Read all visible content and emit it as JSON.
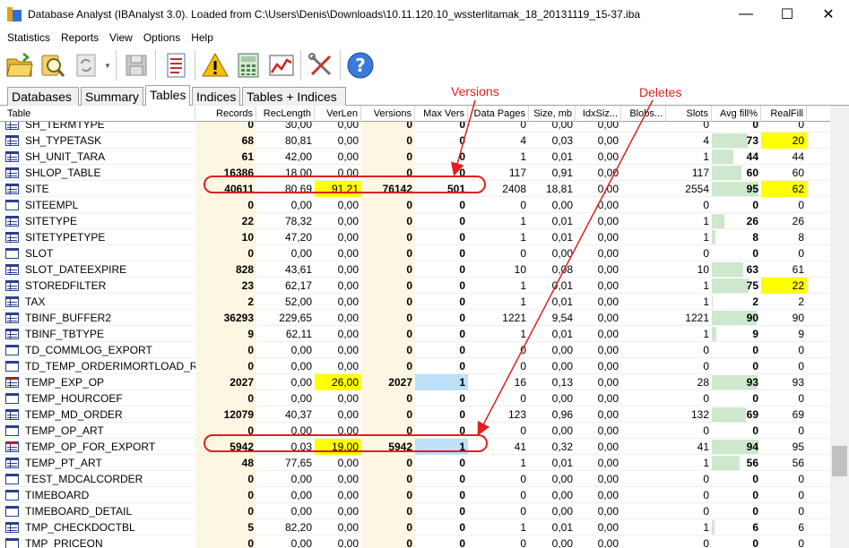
{
  "window": {
    "title": "Database Analyst (IBAnalyst 3.0). Loaded from C:\\Users\\Denis\\Downloads\\10.11.120.10_wssterlitamak_18_20131119_15-37.iba",
    "minimize": "—",
    "maximize": "☐",
    "close": "✕"
  },
  "menu": [
    "Statistics",
    "Reports",
    "View",
    "Options",
    "Help"
  ],
  "toolbar": [
    "open-folder-icon",
    "search-database-icon",
    "refresh-icon",
    "save-icon",
    "report-icon",
    "warning-icon",
    "calculator-icon",
    "chart-icon",
    "tools-icon",
    "help-icon"
  ],
  "tabs": [
    "Databases",
    "Summary",
    "Tables",
    "Indices",
    "Tables + Indices"
  ],
  "active_tab": "Tables",
  "columns": [
    "Table",
    "Records",
    "RecLength",
    "VerLen",
    "Versions",
    "Max Vers",
    "Data Pages",
    "Size, mb",
    "IdxSiz...",
    "Blobs...",
    "Slots",
    "Avg fill%",
    "RealFill"
  ],
  "rows": [
    {
      "name": "SH_TERMTYPE",
      "records": "0",
      "reclength": "30,00",
      "verlen": "0,00",
      "versions": "0",
      "maxvers": "0",
      "datapages": "0",
      "size": "0,00",
      "idxsize": "0,00",
      "blobs": "",
      "slots": "0",
      "avgfill": "0",
      "realfill": "0"
    },
    {
      "name": "SH_TYPETASK",
      "records": "68",
      "reclength": "80,81",
      "verlen": "0,00",
      "versions": "0",
      "maxvers": "0",
      "datapages": "4",
      "size": "0,03",
      "idxsize": "0,00",
      "blobs": "",
      "slots": "4",
      "avgfill": "73",
      "realfill": "20"
    },
    {
      "name": "SH_UNIT_TARA",
      "records": "61",
      "reclength": "42,00",
      "verlen": "0,00",
      "versions": "0",
      "maxvers": "0",
      "datapages": "1",
      "size": "0,01",
      "idxsize": "0,00",
      "blobs": "",
      "slots": "1",
      "avgfill": "44",
      "realfill": "44"
    },
    {
      "name": "SHLOP_TABLE",
      "records": "16386",
      "reclength": "18,00",
      "verlen": "0,00",
      "versions": "0",
      "maxvers": "0",
      "datapages": "117",
      "size": "0,91",
      "idxsize": "0,00",
      "blobs": "",
      "slots": "117",
      "avgfill": "60",
      "realfill": "60"
    },
    {
      "name": "SITE",
      "records": "40611",
      "reclength": "80,69",
      "verlen": "91,21",
      "versions": "76142",
      "maxvers": "501",
      "datapages": "2408",
      "size": "18,81",
      "idxsize": "0,00",
      "blobs": "",
      "slots": "2554",
      "avgfill": "95",
      "realfill": "62"
    },
    {
      "name": "SITEEMPL",
      "records": "0",
      "reclength": "0,00",
      "verlen": "0,00",
      "versions": "0",
      "maxvers": "0",
      "datapages": "0",
      "size": "0,00",
      "idxsize": "0,00",
      "blobs": "",
      "slots": "0",
      "avgfill": "0",
      "realfill": "0"
    },
    {
      "name": "SITETYPE",
      "records": "22",
      "reclength": "78,32",
      "verlen": "0,00",
      "versions": "0",
      "maxvers": "0",
      "datapages": "1",
      "size": "0,01",
      "idxsize": "0,00",
      "blobs": "",
      "slots": "1",
      "avgfill": "26",
      "realfill": "26"
    },
    {
      "name": "SITETYPETYPE",
      "records": "10",
      "reclength": "47,20",
      "verlen": "0,00",
      "versions": "0",
      "maxvers": "0",
      "datapages": "1",
      "size": "0,01",
      "idxsize": "0,00",
      "blobs": "",
      "slots": "1",
      "avgfill": "8",
      "realfill": "8"
    },
    {
      "name": "SLOT",
      "records": "0",
      "reclength": "0,00",
      "verlen": "0,00",
      "versions": "0",
      "maxvers": "0",
      "datapages": "0",
      "size": "0,00",
      "idxsize": "0,00",
      "blobs": "",
      "slots": "0",
      "avgfill": "0",
      "realfill": "0"
    },
    {
      "name": "SLOT_DATEEXPIRE",
      "records": "828",
      "reclength": "43,61",
      "verlen": "0,00",
      "versions": "0",
      "maxvers": "0",
      "datapages": "10",
      "size": "0,08",
      "idxsize": "0,00",
      "blobs": "",
      "slots": "10",
      "avgfill": "63",
      "realfill": "61"
    },
    {
      "name": "STOREDFILTER",
      "records": "23",
      "reclength": "62,17",
      "verlen": "0,00",
      "versions": "0",
      "maxvers": "0",
      "datapages": "1",
      "size": "0,01",
      "idxsize": "0,00",
      "blobs": "",
      "slots": "1",
      "avgfill": "75",
      "realfill": "22"
    },
    {
      "name": "TAX",
      "records": "2",
      "reclength": "52,00",
      "verlen": "0,00",
      "versions": "0",
      "maxvers": "0",
      "datapages": "1",
      "size": "0,01",
      "idxsize": "0,00",
      "blobs": "",
      "slots": "1",
      "avgfill": "2",
      "realfill": "2"
    },
    {
      "name": "TBINF_BUFFER2",
      "records": "36293",
      "reclength": "229,65",
      "verlen": "0,00",
      "versions": "0",
      "maxvers": "0",
      "datapages": "1221",
      "size": "9,54",
      "idxsize": "0,00",
      "blobs": "",
      "slots": "1221",
      "avgfill": "90",
      "realfill": "90"
    },
    {
      "name": "TBINF_TBTYPE",
      "records": "9",
      "reclength": "62,11",
      "verlen": "0,00",
      "versions": "0",
      "maxvers": "0",
      "datapages": "1",
      "size": "0,01",
      "idxsize": "0,00",
      "blobs": "",
      "slots": "1",
      "avgfill": "9",
      "realfill": "9"
    },
    {
      "name": "TD_COMMLOG_EXPORT",
      "records": "0",
      "reclength": "0,00",
      "verlen": "0,00",
      "versions": "0",
      "maxvers": "0",
      "datapages": "0",
      "size": "0,00",
      "idxsize": "0,00",
      "blobs": "",
      "slots": "0",
      "avgfill": "0",
      "realfill": "0"
    },
    {
      "name": "TD_TEMP_ORDERIMORTLOAD_R",
      "records": "0",
      "reclength": "0,00",
      "verlen": "0,00",
      "versions": "0",
      "maxvers": "0",
      "datapages": "0",
      "size": "0,00",
      "idxsize": "0,00",
      "blobs": "",
      "slots": "0",
      "avgfill": "0",
      "realfill": "0"
    },
    {
      "name": "TEMP_EXP_OP",
      "records": "2027",
      "reclength": "0,00",
      "verlen": "26,00",
      "versions": "2027",
      "maxvers": "1",
      "datapages": "16",
      "size": "0,13",
      "idxsize": "0,00",
      "blobs": "",
      "slots": "28",
      "avgfill": "93",
      "realfill": "93"
    },
    {
      "name": "TEMP_HOURCOEF",
      "records": "0",
      "reclength": "0,00",
      "verlen": "0,00",
      "versions": "0",
      "maxvers": "0",
      "datapages": "0",
      "size": "0,00",
      "idxsize": "0,00",
      "blobs": "",
      "slots": "0",
      "avgfill": "0",
      "realfill": "0"
    },
    {
      "name": "TEMP_MD_ORDER",
      "records": "12079",
      "reclength": "40,37",
      "verlen": "0,00",
      "versions": "0",
      "maxvers": "0",
      "datapages": "123",
      "size": "0,96",
      "idxsize": "0,00",
      "blobs": "",
      "slots": "132",
      "avgfill": "69",
      "realfill": "69"
    },
    {
      "name": "TEMP_OP_ART",
      "records": "0",
      "reclength": "0,00",
      "verlen": "0,00",
      "versions": "0",
      "maxvers": "0",
      "datapages": "0",
      "size": "0,00",
      "idxsize": "0,00",
      "blobs": "",
      "slots": "0",
      "avgfill": "0",
      "realfill": "0"
    },
    {
      "name": "TEMP_OP_FOR_EXPORT",
      "records": "5942",
      "reclength": "0,03",
      "verlen": "19,00",
      "versions": "5942",
      "maxvers": "1",
      "datapages": "41",
      "size": "0,32",
      "idxsize": "0,00",
      "blobs": "",
      "slots": "41",
      "avgfill": "94",
      "realfill": "95"
    },
    {
      "name": "TEMP_PT_ART",
      "records": "48",
      "reclength": "77,65",
      "verlen": "0,00",
      "versions": "0",
      "maxvers": "0",
      "datapages": "1",
      "size": "0,01",
      "idxsize": "0,00",
      "blobs": "",
      "slots": "1",
      "avgfill": "56",
      "realfill": "56"
    },
    {
      "name": "TEST_MDCALCORDER",
      "records": "0",
      "reclength": "0,00",
      "verlen": "0,00",
      "versions": "0",
      "maxvers": "0",
      "datapages": "0",
      "size": "0,00",
      "idxsize": "0,00",
      "blobs": "",
      "slots": "0",
      "avgfill": "0",
      "realfill": "0"
    },
    {
      "name": "TIMEBOARD",
      "records": "0",
      "reclength": "0,00",
      "verlen": "0,00",
      "versions": "0",
      "maxvers": "0",
      "datapages": "0",
      "size": "0,00",
      "idxsize": "0,00",
      "blobs": "",
      "slots": "0",
      "avgfill": "0",
      "realfill": "0"
    },
    {
      "name": "TIMEBOARD_DETAIL",
      "records": "0",
      "reclength": "0,00",
      "verlen": "0,00",
      "versions": "0",
      "maxvers": "0",
      "datapages": "0",
      "size": "0,00",
      "idxsize": "0,00",
      "blobs": "",
      "slots": "0",
      "avgfill": "0",
      "realfill": "0"
    },
    {
      "name": "TMP_CHECKDOCTBL",
      "records": "5",
      "reclength": "82,20",
      "verlen": "0,00",
      "versions": "0",
      "maxvers": "0",
      "datapages": "1",
      "size": "0,01",
      "idxsize": "0,00",
      "blobs": "",
      "slots": "1",
      "avgfill": "6",
      "realfill": "6"
    },
    {
      "name": "TMP_PRICEON",
      "records": "0",
      "reclength": "0,00",
      "verlen": "0,00",
      "versions": "0",
      "maxvers": "0",
      "datapages": "0",
      "size": "0,00",
      "idxsize": "0,00",
      "blobs": "",
      "slots": "0",
      "avgfill": "0",
      "realfill": "0"
    }
  ],
  "highlights": {
    "verlen_yellow": [
      "SITE",
      "TEMP_EXP_OP",
      "TEMP_OP_FOR_EXPORT"
    ],
    "maxvers_blue": [
      "TEMP_EXP_OP",
      "TEMP_OP_FOR_EXPORT"
    ],
    "realfill_yellow": [
      "SH_TYPETASK",
      "SITE",
      "STOREDFILTER"
    ],
    "red_icon_rows": [
      "TEMP_EXP_OP",
      "TEMP_OP_FOR_EXPORT"
    ],
    "outline_icon_rows": [
      "SITEEMPL",
      "SLOT",
      "TD_COMMLOG_EXPORT",
      "TD_TEMP_ORDERIMORTLOAD_R",
      "TEMP_HOURCOEF",
      "TEMP_OP_ART",
      "TEST_MDCALCORDER",
      "TIMEBOARD",
      "TIMEBOARD_DETAIL",
      "TMP_PRICEON"
    ]
  },
  "annotations": {
    "versions_label": "Versions",
    "deletes_label": "Deletes",
    "color": "#e02020"
  },
  "colors": {
    "records_bg": "#fdf6e3",
    "versions_bg": "#fdf6e3",
    "fill_bar": "#cde8cd",
    "yellow": "#ffff00",
    "blue": "#bde0fb"
  }
}
